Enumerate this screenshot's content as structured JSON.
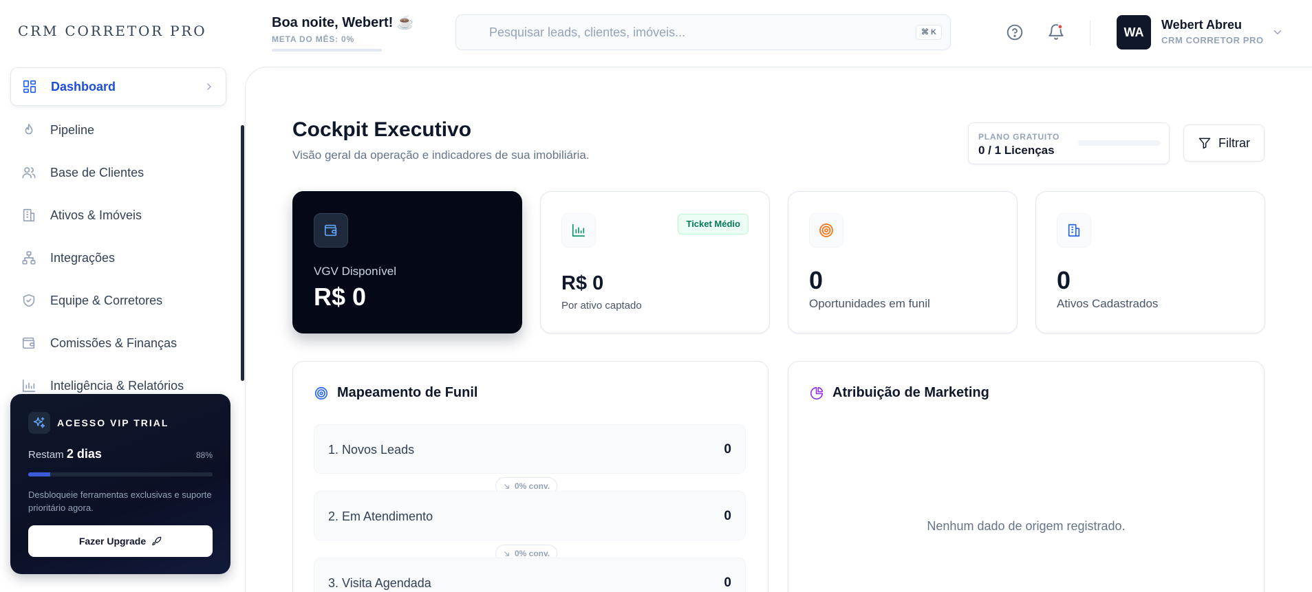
{
  "header": {
    "brand": "CRM CORRETOR PRO",
    "greeting": "Boa noite, Webert! ☕",
    "goal_label": "META DO MÊS: 0%",
    "goal_percent": 0,
    "search_placeholder": "Pesquisar leads, clientes, imóveis...",
    "search_shortcut": "⌘ K",
    "user_initials": "WA",
    "user_name": "Webert Abreu",
    "user_subtitle": "CRM CORRETOR PRO"
  },
  "sidebar": {
    "items": [
      {
        "label": "Dashboard",
        "icon": "dashboard-grid-icon",
        "active": true
      },
      {
        "label": "Pipeline",
        "icon": "flame-icon"
      },
      {
        "label": "Base de Clientes",
        "icon": "users-icon"
      },
      {
        "label": "Ativos & Imóveis",
        "icon": "building-icon"
      },
      {
        "label": "Integrações",
        "icon": "network-icon"
      },
      {
        "label": "Equipe & Corretores",
        "icon": "shield-icon"
      },
      {
        "label": "Comissões & Finanças",
        "icon": "wallet-icon"
      },
      {
        "label": "Inteligência & Relatórios",
        "icon": "bar-chart-icon"
      }
    ],
    "vip": {
      "title": "ACESSO VIP TRIAL",
      "remaining_prefix": "Restam",
      "remaining_days": "2 dias",
      "percent_label": "88%",
      "progress_percent": 12,
      "description": "Desbloqueie ferramentas exclusivas e suporte prioritário agora.",
      "button_label": "Fazer Upgrade"
    }
  },
  "main": {
    "title": "Cockpit Executivo",
    "subtitle": "Visão geral da operação e indicadores de sua imobiliária.",
    "plan": {
      "label": "PLANO GRATUITO",
      "value": "0 / 1 Licenças",
      "usage_percent": 0
    },
    "filter_label": "Filtrar",
    "cards": [
      {
        "label": "VGV Disponível",
        "value": "R$ 0",
        "icon": "wallet-icon"
      },
      {
        "badge": "Ticket Médio",
        "value": "R$ 0",
        "caption": "Por ativo captado",
        "icon": "bar-chart-icon"
      },
      {
        "value": "0",
        "caption": "Oportunidades em funil",
        "icon": "target-icon"
      },
      {
        "value": "0",
        "caption": "Ativos Cadastrados",
        "icon": "building-icon"
      }
    ],
    "funnel": {
      "title": "Mapeamento de Funil",
      "stages": [
        {
          "name": "1. Novos Leads",
          "count": "0"
        },
        {
          "name": "2. Em Atendimento",
          "count": "0"
        },
        {
          "name": "3. Visita Agendada",
          "count": "0"
        }
      ],
      "conversions": [
        "0% conv.",
        "0% conv."
      ]
    },
    "marketing": {
      "title": "Atribuição de Marketing",
      "empty_message": "Nenhum dado de origem registrado."
    }
  },
  "colors": {
    "accent": "#2563eb",
    "dark_card": "#050816",
    "success": "#047857",
    "orange": "#f97316",
    "purple": "#9333ea"
  }
}
